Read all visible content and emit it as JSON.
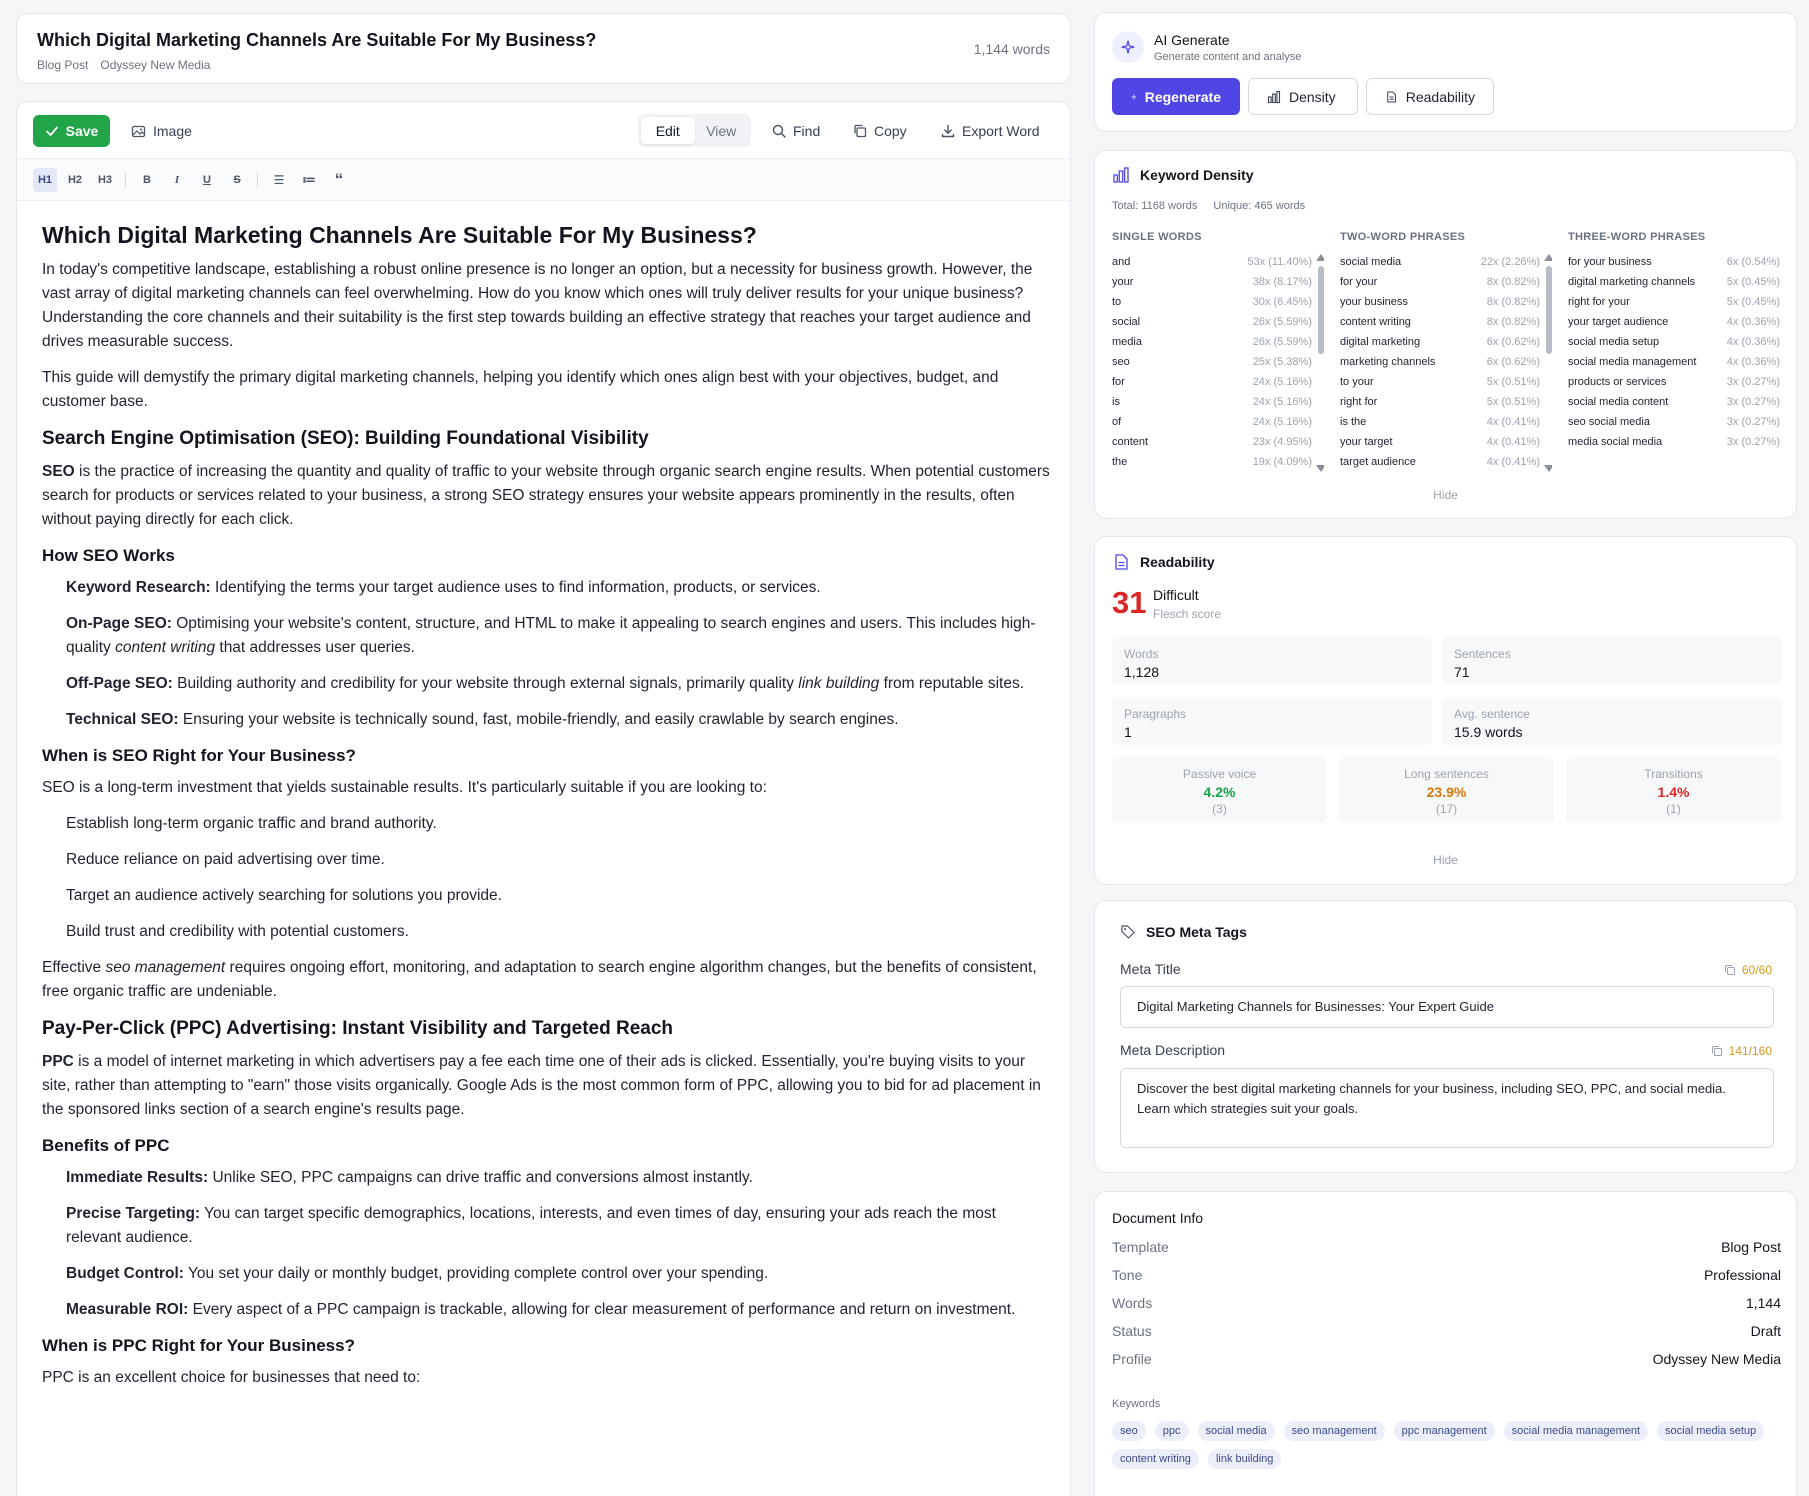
{
  "header": {
    "title": "Which Digital Marketing Channels Are Suitable For My Business?",
    "template": "Blog Post",
    "profile": "Odyssey New Media",
    "word_count": "1,144 words"
  },
  "toolbar": {
    "save": "Save",
    "image": "Image",
    "edit": "Edit",
    "view": "View",
    "find": "Find",
    "copy": "Copy",
    "export": "Export Word"
  },
  "format": {
    "h1": "H1",
    "h2": "H2",
    "h3": "H3",
    "bold": "B",
    "italic": "I",
    "underline": "U",
    "strike": "S",
    "bullet": "☰",
    "numbered": "≔",
    "quote": "“"
  },
  "content": {
    "h1": "Which Digital Marketing Channels Are Suitable For My Business?",
    "p1": "In today's competitive landscape, establishing a robust online presence is no longer an option, but a necessity for business growth. However, the vast array of digital marketing channels can feel overwhelming. How do you know which ones will truly deliver results for your unique business? Understanding the core channels and their suitability is the first step towards building an effective strategy that reaches your target audience and drives measurable success.",
    "p2": "This guide will demystify the primary digital marketing channels, helping you identify which ones align best with your objectives, budget, and customer base.",
    "seo_h2": "Search Engine Optimisation (SEO): Building Foundational Visibility",
    "seo_def_b": "SEO",
    "seo_def": " is the practice of increasing the quantity and quality of traffic to your website through organic search engine results. When potential customers search for products or services related to your business, a strong SEO strategy ensures your website appears prominently in the results, often without paying directly for each click.",
    "how_seo_h3": "How SEO Works",
    "kr_b": "Keyword Research:",
    "kr": " Identifying the terms your target audience uses to find information, products, or services.",
    "onpage_b": "On-Page SEO:",
    "onpage_1": " Optimising your website's content, structure, and HTML to make it appealing to search engines and users. This includes high-quality ",
    "onpage_i": "content writing",
    "onpage_2": " that addresses user queries.",
    "offpage_b": "Off-Page SEO:",
    "offpage_1": " Building authority and credibility for your website through external signals, primarily quality ",
    "offpage_i": "link building",
    "offpage_2": " from reputable sites.",
    "tech_b": "Technical SEO:",
    "tech": " Ensuring your website is technically sound, fast, mobile-friendly, and easily crawlable by search engines.",
    "when_seo_h3": "When is SEO Right for Your Business?",
    "when_seo_p": "SEO is a long-term investment that yields sustainable results. It's particularly suitable if you are looking to:",
    "seo_list": [
      "Establish long-term organic traffic and brand authority.",
      "Reduce reliance on paid advertising over time.",
      "Target an audience actively searching for solutions you provide.",
      "Build trust and credibility with potential customers."
    ],
    "eff_1": "Effective ",
    "eff_i": "seo management",
    "eff_2": " requires ongoing effort, monitoring, and adaptation to search engine algorithm changes, but the benefits of consistent, free organic traffic are undeniable.",
    "ppc_h2": "Pay-Per-Click (PPC) Advertising: Instant Visibility and Targeted Reach",
    "ppc_def_b": "PPC",
    "ppc_def": " is a model of internet marketing in which advertisers pay a fee each time one of their ads is clicked. Essentially, you're buying visits to your site, rather than attempting to \"earn\" those visits organically. Google Ads is the most common form of PPC, allowing you to bid for ad placement in the sponsored links section of a search engine's results page.",
    "ben_h3": "Benefits of PPC",
    "imm_b": "Immediate Results:",
    "imm": " Unlike SEO, PPC campaigns can drive traffic and conversions almost instantly.",
    "prec_b": "Precise Targeting:",
    "prec": " You can target specific demographics, locations, interests, and even times of day, ensuring your ads reach the most relevant audience.",
    "bud_b": "Budget Control:",
    "bud": " You set your daily or monthly budget, providing complete control over your spending.",
    "roi_b": "Measurable ROI:",
    "roi": " Every aspect of a PPC campaign is trackable, allowing for clear measurement of performance and return on investment.",
    "when_ppc_h3": "When is PPC Right for Your Business?",
    "when_ppc_p": "PPC is an excellent choice for businesses that need to:"
  },
  "ai": {
    "title": "AI Generate",
    "subtitle": "Generate content and analyse",
    "regenerate": "Regenerate",
    "density": "Density",
    "readability": "Readability"
  },
  "keyword_density": {
    "title": "Keyword Density",
    "total": "Total: 1168 words",
    "unique": "Unique: 465 words",
    "hide": "Hide",
    "single_header": "SINGLE WORDS",
    "two_header": "TWO-WORD PHRASES",
    "three_header": "THREE-WORD PHRASES",
    "single": [
      {
        "w": "and",
        "v": "53x (11.40%)"
      },
      {
        "w": "your",
        "v": "38x (8.17%)"
      },
      {
        "w": "to",
        "v": "30x (6.45%)"
      },
      {
        "w": "social",
        "v": "26x (5.59%)"
      },
      {
        "w": "media",
        "v": "26x (5.59%)"
      },
      {
        "w": "seo",
        "v": "25x (5.38%)"
      },
      {
        "w": "for",
        "v": "24x (5.16%)"
      },
      {
        "w": "is",
        "v": "24x (5.16%)"
      },
      {
        "w": "of",
        "v": "24x (5.16%)"
      },
      {
        "w": "content",
        "v": "23x (4.95%)"
      },
      {
        "w": "the",
        "v": "19x (4.09%)"
      }
    ],
    "two": [
      {
        "w": "social media",
        "v": "22x (2.26%)"
      },
      {
        "w": "for your",
        "v": "8x (0.82%)"
      },
      {
        "w": "your business",
        "v": "8x (0.82%)"
      },
      {
        "w": "content writing",
        "v": "8x (0.82%)"
      },
      {
        "w": "digital marketing",
        "v": "6x (0.62%)"
      },
      {
        "w": "marketing channels",
        "v": "6x (0.62%)"
      },
      {
        "w": "to your",
        "v": "5x (0.51%)"
      },
      {
        "w": "right for",
        "v": "5x (0.51%)"
      },
      {
        "w": "is the",
        "v": "4x (0.41%)"
      },
      {
        "w": "your target",
        "v": "4x (0.41%)"
      },
      {
        "w": "target audience",
        "v": "4x (0.41%)"
      }
    ],
    "three": [
      {
        "w": "for your business",
        "v": "6x (0.54%)"
      },
      {
        "w": "digital marketing channels",
        "v": "5x (0.45%)"
      },
      {
        "w": "right for your",
        "v": "5x (0.45%)"
      },
      {
        "w": "your target audience",
        "v": "4x (0.36%)"
      },
      {
        "w": "social media setup",
        "v": "4x (0.36%)"
      },
      {
        "w": "social media management",
        "v": "4x (0.36%)"
      },
      {
        "w": "products or services",
        "v": "3x (0.27%)"
      },
      {
        "w": "social media content",
        "v": "3x (0.27%)"
      },
      {
        "w": "seo social media",
        "v": "3x (0.27%)"
      },
      {
        "w": "media social media",
        "v": "3x (0.27%)"
      }
    ]
  },
  "readability": {
    "title": "Readability",
    "score": "31",
    "level": "Difficult",
    "score_label": "Flesch score",
    "words_label": "Words",
    "words": "1,128",
    "sentences_label": "Sentences",
    "sentences": "71",
    "paragraphs_label": "Paragraphs",
    "paragraphs": "1",
    "avg_label": "Avg. sentence",
    "avg": "15.9 words",
    "passive_label": "Passive voice",
    "passive": "4.2%",
    "passive_count": "(3)",
    "long_label": "Long sentences",
    "long": "23.9%",
    "long_count": "(17)",
    "trans_label": "Transitions",
    "trans": "1.4%",
    "trans_count": "(1)",
    "hide": "Hide",
    "colors": {
      "good": "#16a34a",
      "warn": "#d97706",
      "bad": "#dc2626"
    }
  },
  "seo_meta": {
    "title": "SEO Meta Tags",
    "meta_title_label": "Meta Title",
    "meta_title_count": "60/60",
    "meta_title": "Digital Marketing Channels for Businesses: Your Expert Guide",
    "meta_desc_label": "Meta Description",
    "meta_desc_count": "141/160",
    "meta_desc": "Discover the best digital marketing channels for your business, including SEO, PPC, and social media. Learn which strategies suit your goals."
  },
  "doc_info": {
    "title": "Document Info",
    "rows": [
      {
        "k": "Template",
        "v": "Blog Post"
      },
      {
        "k": "Tone",
        "v": "Professional"
      },
      {
        "k": "Words",
        "v": "1,144"
      },
      {
        "k": "Status",
        "v": "Draft"
      },
      {
        "k": "Profile",
        "v": "Odyssey New Media"
      }
    ],
    "keywords_label": "Keywords",
    "keywords": [
      "seo",
      "ppc",
      "social media",
      "seo management",
      "ppc management",
      "social media management",
      "social media setup",
      "content writing",
      "link building"
    ]
  }
}
